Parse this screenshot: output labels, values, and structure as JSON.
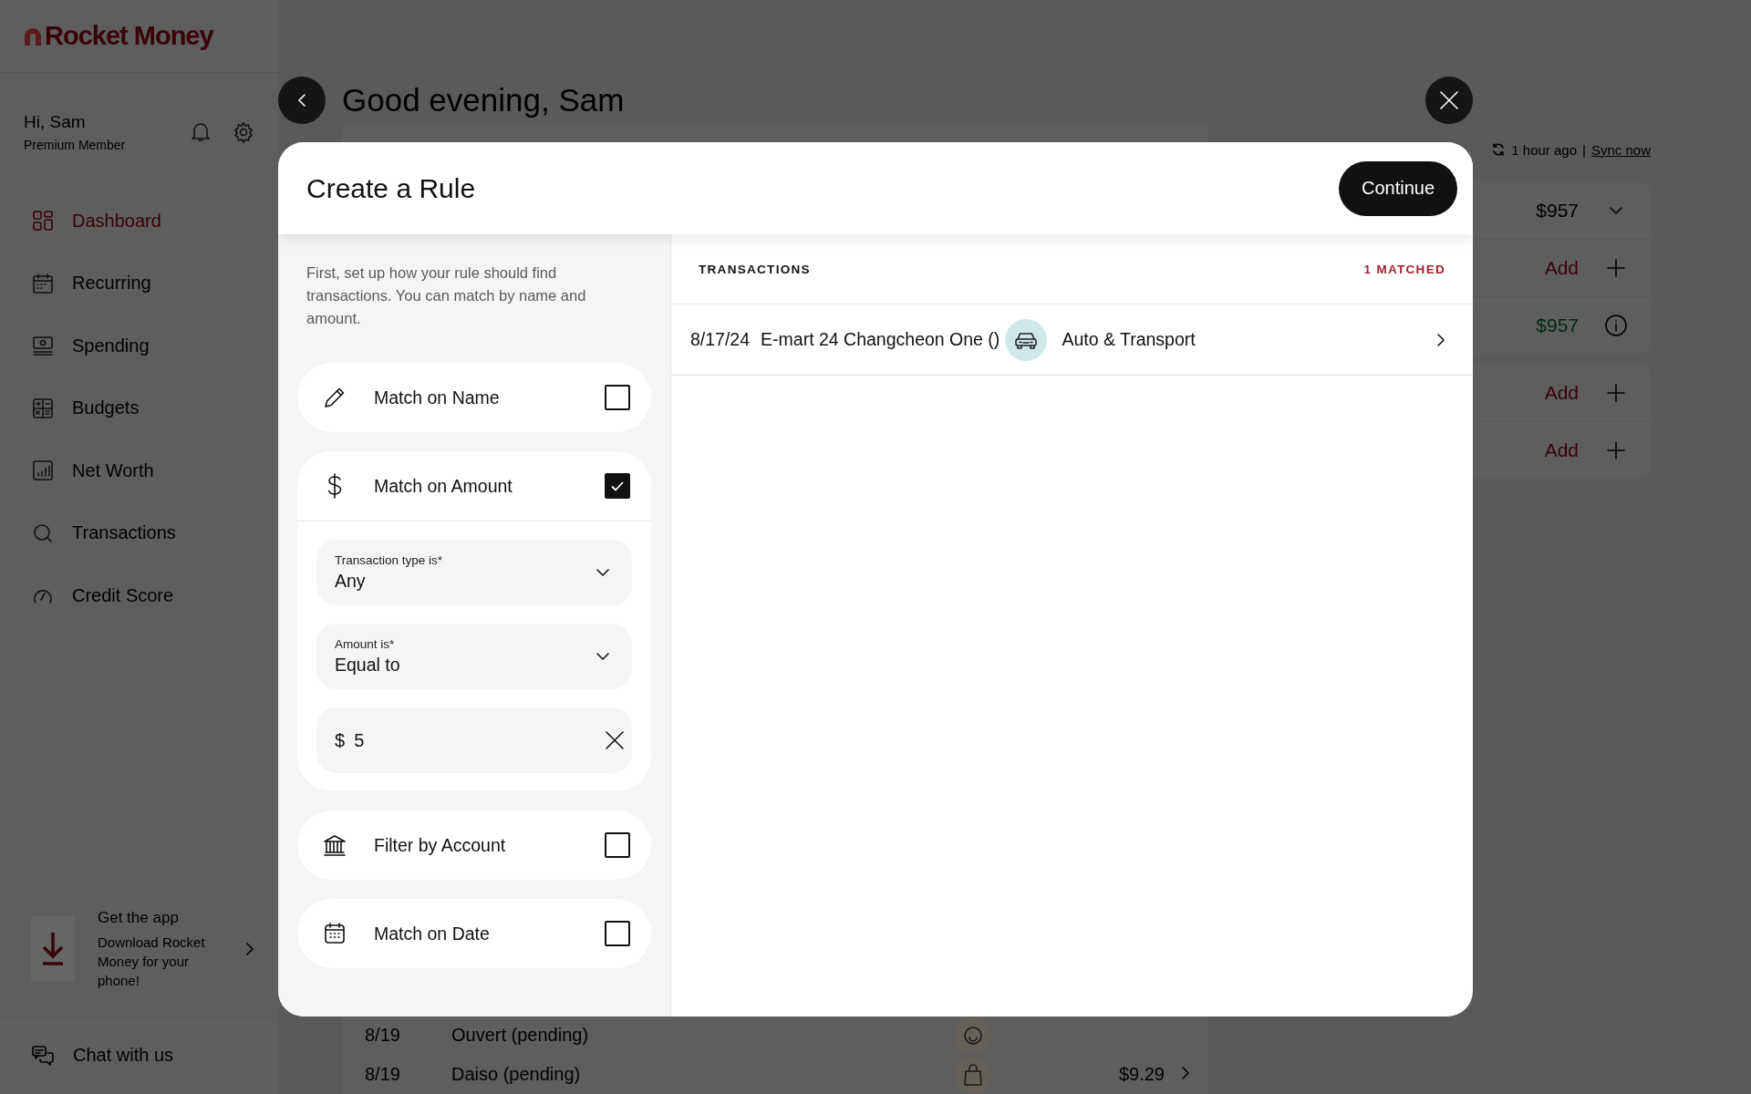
{
  "sidebar": {
    "logo": "Rocket Money",
    "greeting": "Hi, Sam",
    "membership": "Premium Member",
    "nav": [
      {
        "label": "Dashboard",
        "selected": true
      },
      {
        "label": "Recurring",
        "selected": false
      },
      {
        "label": "Spending",
        "selected": false
      },
      {
        "label": "Budgets",
        "selected": false
      },
      {
        "label": "Net Worth",
        "selected": false
      },
      {
        "label": "Transactions",
        "selected": false
      },
      {
        "label": "Credit Score",
        "selected": false
      }
    ],
    "promo": {
      "title": "Get the app",
      "text": "Download Rocket Money for your phone!"
    },
    "chat": "Chat with us"
  },
  "header": {
    "greeting": "Good evening, Sam",
    "sync_time": "1 hour ago",
    "sync_separator": "|",
    "sync_link": "Sync now"
  },
  "summary_cards": [
    {
      "rows": [
        {
          "kind": "amount",
          "value": "$957"
        },
        {
          "kind": "add",
          "value": "Add"
        },
        {
          "kind": "positive",
          "value": "$957"
        }
      ]
    },
    {
      "rows": [
        {
          "kind": "add",
          "value": "Add"
        },
        {
          "kind": "add",
          "value": "Add"
        }
      ]
    }
  ],
  "recent_transactions": [
    {
      "date": "8/19",
      "name": "Ouvert (pending)"
    },
    {
      "date": "8/19",
      "name": "Daiso (pending)",
      "amount": "$9.29"
    }
  ],
  "modal": {
    "title": "Create a Rule",
    "continue": "Continue",
    "intro": "First, set up how your rule should find transactions. You can match by name and amount.",
    "criteria": [
      {
        "kind": "name",
        "label": "Match on Name",
        "checked": false
      },
      {
        "kind": "amount",
        "label": "Match on Amount",
        "checked": true,
        "selects": [
          {
            "label": "Transaction type is*",
            "value": "Any"
          },
          {
            "label": "Amount is*",
            "value": "Equal to"
          }
        ],
        "amount_input": {
          "prefix": "$",
          "value": "5"
        }
      },
      {
        "kind": "account",
        "label": "Filter by Account",
        "checked": false
      },
      {
        "kind": "date",
        "label": "Match on Date",
        "checked": false
      }
    ],
    "transactions": {
      "heading": "TRANSACTIONS",
      "count": "1 MATCHED",
      "rows": [
        {
          "date": "8/17/24",
          "name": "E-mart 24 Changcheon One ()",
          "category": "Auto & Transport"
        }
      ]
    }
  }
}
